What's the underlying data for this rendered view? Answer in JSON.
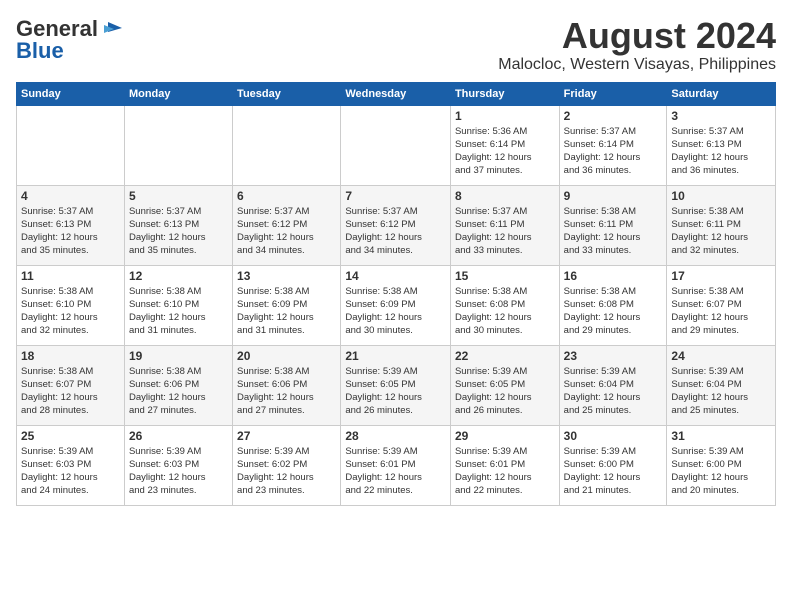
{
  "logo": {
    "general": "General",
    "blue": "Blue"
  },
  "title": "August 2024",
  "location": "Malocloc, Western Visayas, Philippines",
  "days_of_week": [
    "Sunday",
    "Monday",
    "Tuesday",
    "Wednesday",
    "Thursday",
    "Friday",
    "Saturday"
  ],
  "weeks": [
    [
      {
        "day": "",
        "info": ""
      },
      {
        "day": "",
        "info": ""
      },
      {
        "day": "",
        "info": ""
      },
      {
        "day": "",
        "info": ""
      },
      {
        "day": "1",
        "info": "Sunrise: 5:36 AM\nSunset: 6:14 PM\nDaylight: 12 hours\nand 37 minutes."
      },
      {
        "day": "2",
        "info": "Sunrise: 5:37 AM\nSunset: 6:14 PM\nDaylight: 12 hours\nand 36 minutes."
      },
      {
        "day": "3",
        "info": "Sunrise: 5:37 AM\nSunset: 6:13 PM\nDaylight: 12 hours\nand 36 minutes."
      }
    ],
    [
      {
        "day": "4",
        "info": "Sunrise: 5:37 AM\nSunset: 6:13 PM\nDaylight: 12 hours\nand 35 minutes."
      },
      {
        "day": "5",
        "info": "Sunrise: 5:37 AM\nSunset: 6:13 PM\nDaylight: 12 hours\nand 35 minutes."
      },
      {
        "day": "6",
        "info": "Sunrise: 5:37 AM\nSunset: 6:12 PM\nDaylight: 12 hours\nand 34 minutes."
      },
      {
        "day": "7",
        "info": "Sunrise: 5:37 AM\nSunset: 6:12 PM\nDaylight: 12 hours\nand 34 minutes."
      },
      {
        "day": "8",
        "info": "Sunrise: 5:37 AM\nSunset: 6:11 PM\nDaylight: 12 hours\nand 33 minutes."
      },
      {
        "day": "9",
        "info": "Sunrise: 5:38 AM\nSunset: 6:11 PM\nDaylight: 12 hours\nand 33 minutes."
      },
      {
        "day": "10",
        "info": "Sunrise: 5:38 AM\nSunset: 6:11 PM\nDaylight: 12 hours\nand 32 minutes."
      }
    ],
    [
      {
        "day": "11",
        "info": "Sunrise: 5:38 AM\nSunset: 6:10 PM\nDaylight: 12 hours\nand 32 minutes."
      },
      {
        "day": "12",
        "info": "Sunrise: 5:38 AM\nSunset: 6:10 PM\nDaylight: 12 hours\nand 31 minutes."
      },
      {
        "day": "13",
        "info": "Sunrise: 5:38 AM\nSunset: 6:09 PM\nDaylight: 12 hours\nand 31 minutes."
      },
      {
        "day": "14",
        "info": "Sunrise: 5:38 AM\nSunset: 6:09 PM\nDaylight: 12 hours\nand 30 minutes."
      },
      {
        "day": "15",
        "info": "Sunrise: 5:38 AM\nSunset: 6:08 PM\nDaylight: 12 hours\nand 30 minutes."
      },
      {
        "day": "16",
        "info": "Sunrise: 5:38 AM\nSunset: 6:08 PM\nDaylight: 12 hours\nand 29 minutes."
      },
      {
        "day": "17",
        "info": "Sunrise: 5:38 AM\nSunset: 6:07 PM\nDaylight: 12 hours\nand 29 minutes."
      }
    ],
    [
      {
        "day": "18",
        "info": "Sunrise: 5:38 AM\nSunset: 6:07 PM\nDaylight: 12 hours\nand 28 minutes."
      },
      {
        "day": "19",
        "info": "Sunrise: 5:38 AM\nSunset: 6:06 PM\nDaylight: 12 hours\nand 27 minutes."
      },
      {
        "day": "20",
        "info": "Sunrise: 5:38 AM\nSunset: 6:06 PM\nDaylight: 12 hours\nand 27 minutes."
      },
      {
        "day": "21",
        "info": "Sunrise: 5:39 AM\nSunset: 6:05 PM\nDaylight: 12 hours\nand 26 minutes."
      },
      {
        "day": "22",
        "info": "Sunrise: 5:39 AM\nSunset: 6:05 PM\nDaylight: 12 hours\nand 26 minutes."
      },
      {
        "day": "23",
        "info": "Sunrise: 5:39 AM\nSunset: 6:04 PM\nDaylight: 12 hours\nand 25 minutes."
      },
      {
        "day": "24",
        "info": "Sunrise: 5:39 AM\nSunset: 6:04 PM\nDaylight: 12 hours\nand 25 minutes."
      }
    ],
    [
      {
        "day": "25",
        "info": "Sunrise: 5:39 AM\nSunset: 6:03 PM\nDaylight: 12 hours\nand 24 minutes."
      },
      {
        "day": "26",
        "info": "Sunrise: 5:39 AM\nSunset: 6:03 PM\nDaylight: 12 hours\nand 23 minutes."
      },
      {
        "day": "27",
        "info": "Sunrise: 5:39 AM\nSunset: 6:02 PM\nDaylight: 12 hours\nand 23 minutes."
      },
      {
        "day": "28",
        "info": "Sunrise: 5:39 AM\nSunset: 6:01 PM\nDaylight: 12 hours\nand 22 minutes."
      },
      {
        "day": "29",
        "info": "Sunrise: 5:39 AM\nSunset: 6:01 PM\nDaylight: 12 hours\nand 22 minutes."
      },
      {
        "day": "30",
        "info": "Sunrise: 5:39 AM\nSunset: 6:00 PM\nDaylight: 12 hours\nand 21 minutes."
      },
      {
        "day": "31",
        "info": "Sunrise: 5:39 AM\nSunset: 6:00 PM\nDaylight: 12 hours\nand 20 minutes."
      }
    ]
  ]
}
